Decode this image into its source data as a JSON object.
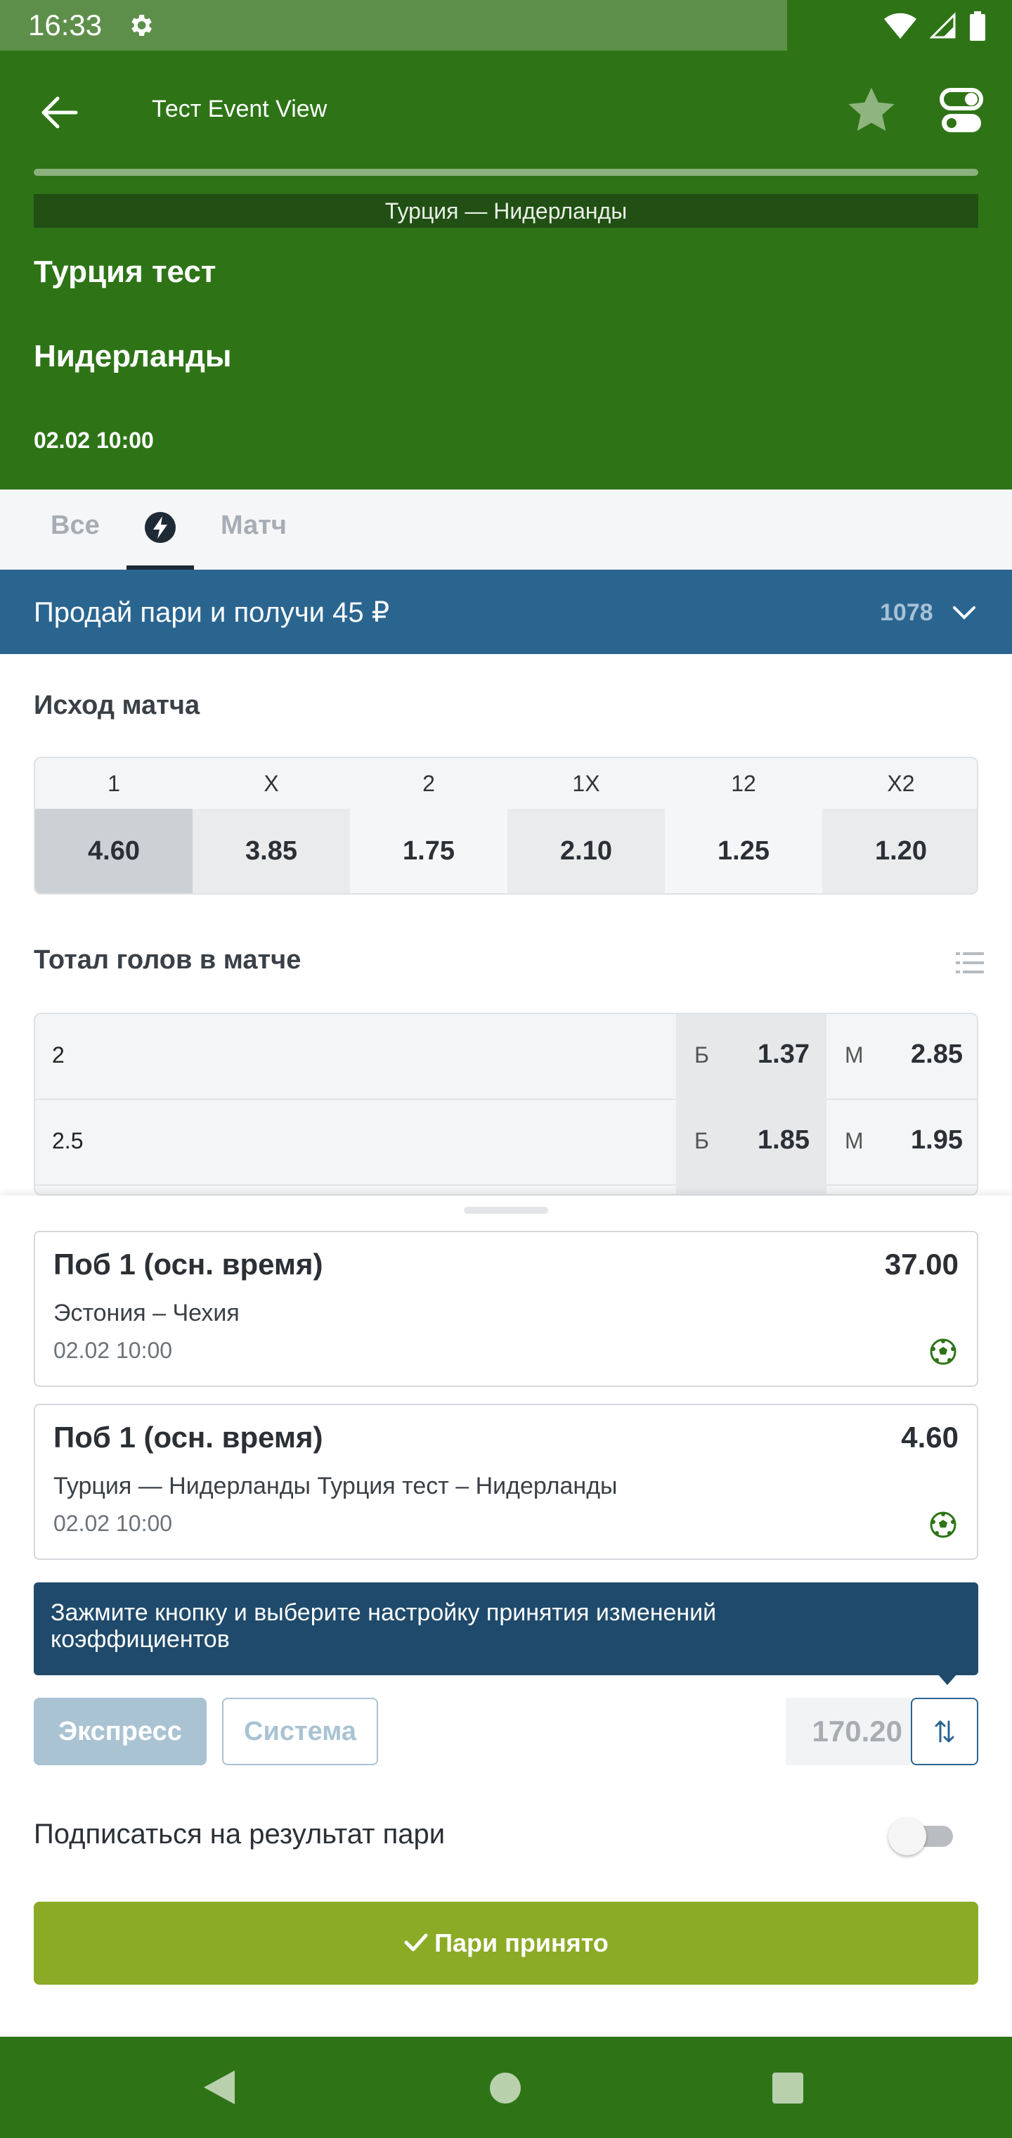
{
  "status_bar": {
    "time": "16:33"
  },
  "header": {
    "title": "Тест Event View",
    "match_name": "Турция — Нидерланды",
    "team1": "Турция тест",
    "team2": "Нидерланды",
    "datetime": "02.02 10:00"
  },
  "tabs": [
    {
      "label": "Все"
    },
    {
      "icon": "live-bolt-icon"
    },
    {
      "label": "Матч"
    }
  ],
  "promo": {
    "text": "Продай пари и получи 45 ₽",
    "count": "1078"
  },
  "outcome": {
    "title": "Исход матча",
    "headers": [
      "1",
      "X",
      "2",
      "1X",
      "12",
      "X2"
    ],
    "values": [
      "4.60",
      "3.85",
      "1.75",
      "2.10",
      "1.25",
      "1.20"
    ]
  },
  "totals": {
    "title": "Тотал голов в матче",
    "rows": [
      {
        "line": "2",
        "over_label": "Б",
        "over": "1.37",
        "under_label": "М",
        "under": "2.85"
      },
      {
        "line": "2.5",
        "over_label": "Б",
        "over": "1.85",
        "under_label": "М",
        "under": "1.95"
      }
    ]
  },
  "betslip": {
    "bets": [
      {
        "title": "Поб 1 (осн. время)",
        "odds": "37.00",
        "match": "Эстония – Чехия",
        "date": "02.02 10:00"
      },
      {
        "title": "Поб 1 (осн. время)",
        "odds": "4.60",
        "match": "Турция — Нидерланды Турция тест – Нидерланды",
        "date": "02.02 10:00"
      }
    ],
    "tooltip": "Зажмите кнопку и выберите настройку принятия изменений коэффициентов",
    "express_label": "Экспресс",
    "system_label": "Система",
    "stake": "170.20",
    "subscribe_label": "Подписаться на результат пари",
    "accept_label": "Пари принято"
  },
  "colors": {
    "header_green": "#2e7417",
    "promo_blue": "#2a6590",
    "accept_green": "#8bab26"
  }
}
